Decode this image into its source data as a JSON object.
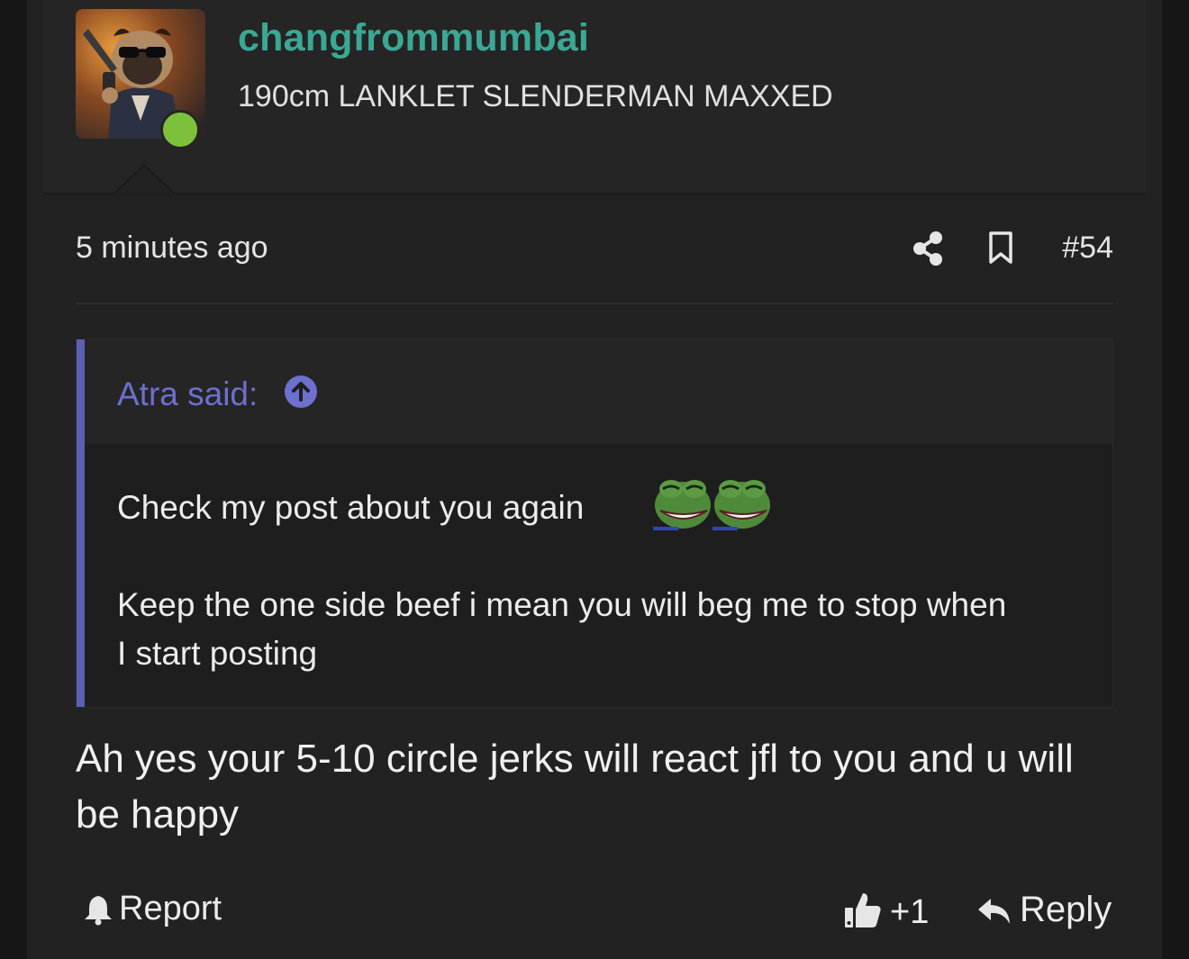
{
  "post": {
    "username": "changfrommumbai",
    "user_title": "190cm LANKLET SLENDERMAN MAXXED",
    "timestamp": "5 minutes ago",
    "post_number": "#54",
    "online_color": "#7dc13a",
    "username_color": "#3aa894"
  },
  "quote": {
    "author": "Atra said:",
    "line1": "Check my post about you again",
    "line2": "Keep the one side beef i mean you will beg me to stop when",
    "line3": "I start posting",
    "smilies": [
      "pepe-laugh-emoji",
      "pepe-laugh-emoji"
    ],
    "accent_color": "#5b5fb5"
  },
  "body": {
    "text": "Ah yes your 5-10 circle jerks will react jfl to you and u will be happy"
  },
  "footer": {
    "report_label": "Report",
    "like_count": "+1",
    "reply_label": "Reply"
  },
  "icons": {
    "share": "share-icon",
    "bookmark": "bookmark-icon",
    "quote_jump": "arrow-up-circle-icon",
    "report": "bell-icon",
    "like": "thumbs-up-icon",
    "reply": "reply-arrow-icon"
  }
}
